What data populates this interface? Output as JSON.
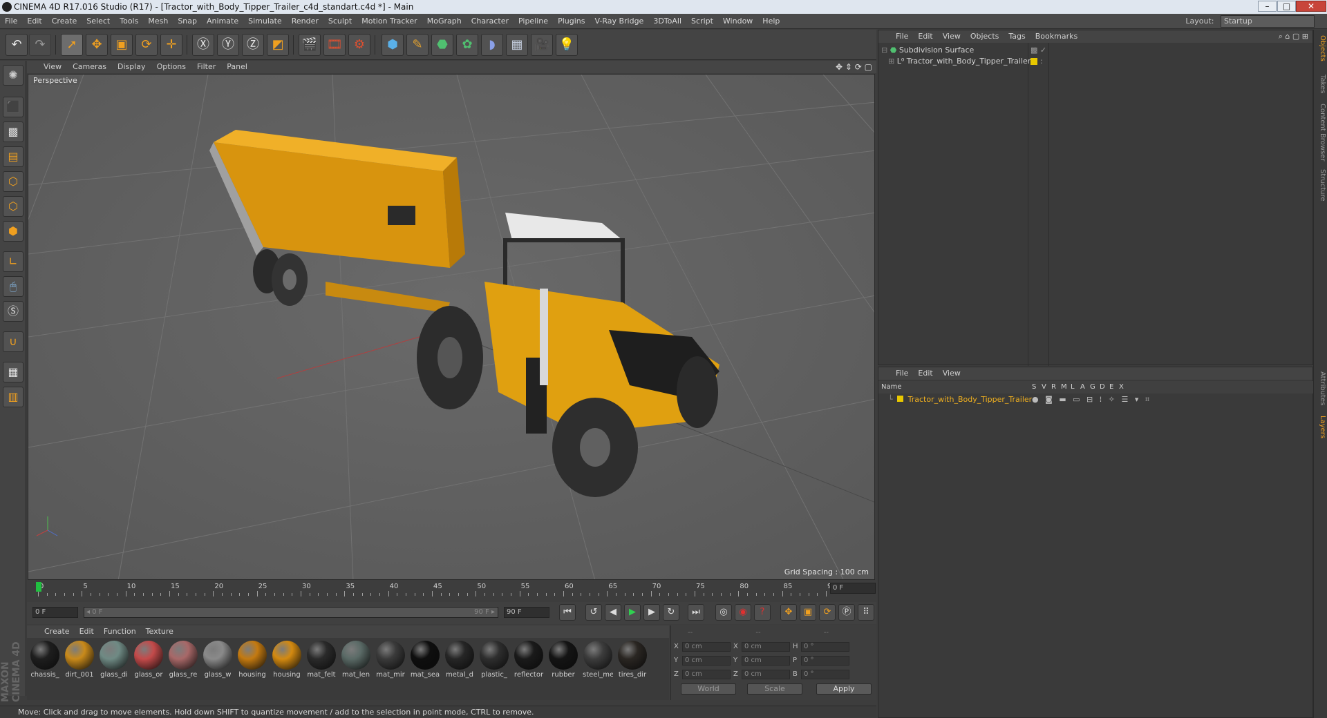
{
  "window": {
    "title": "CINEMA 4D R17.016 Studio (R17) - [Tractor_with_Body_Tipper_Trailer_c4d_standart.c4d *] - Main",
    "min": "–",
    "max": "□",
    "close": "✕"
  },
  "menu": [
    "File",
    "Edit",
    "Create",
    "Select",
    "Tools",
    "Mesh",
    "Snap",
    "Animate",
    "Simulate",
    "Render",
    "Sculpt",
    "Motion Tracker",
    "MoGraph",
    "Character",
    "Pipeline",
    "Plugins",
    "V-Ray Bridge",
    "3DToAll",
    "Script",
    "Window",
    "Help"
  ],
  "layout": {
    "label": "Layout:",
    "value": "Startup"
  },
  "viewport": {
    "menu": [
      "View",
      "Cameras",
      "Display",
      "Options",
      "Filter",
      "Panel"
    ],
    "camera_label": "Perspective",
    "grid_spacing": "Grid Spacing : 100 cm"
  },
  "timeline": {
    "ticks": [
      "0",
      "5",
      "10",
      "15",
      "20",
      "25",
      "30",
      "35",
      "40",
      "45",
      "50",
      "55",
      "60",
      "65",
      "70",
      "75",
      "80",
      "85",
      "90"
    ],
    "current_frame": "0 F"
  },
  "transport": {
    "start": "0 F",
    "range_start": "◂ 0 F",
    "range_end": "90 F ▸",
    "end": "90 F"
  },
  "materials": {
    "menu": [
      "Create",
      "Edit",
      "Function",
      "Texture"
    ],
    "items": [
      {
        "label": "chassis_",
        "color": "#1e1e1e"
      },
      {
        "label": "dirt_001",
        "color": "#c98a1a"
      },
      {
        "label": "glass_di",
        "color": "#6f8a84"
      },
      {
        "label": "glass_or",
        "color": "#c44a4a"
      },
      {
        "label": "glass_re",
        "color": "#a86868"
      },
      {
        "label": "glass_w",
        "color": "#8a8a8a"
      },
      {
        "label": "housing",
        "color": "#c47a10"
      },
      {
        "label": "housing",
        "color": "#d48a10"
      },
      {
        "label": "mat_felt",
        "color": "#2a2a2a"
      },
      {
        "label": "mat_len",
        "color": "#5a6a66"
      },
      {
        "label": "mat_mir",
        "color": "#3a3a3a"
      },
      {
        "label": "mat_sea",
        "color": "#0e0e0e"
      },
      {
        "label": "metal_d",
        "color": "#262626"
      },
      {
        "label": "plastic_",
        "color": "#2e2e2e"
      },
      {
        "label": "reflector",
        "color": "#1a1a1a"
      },
      {
        "label": "rubber",
        "color": "#141414"
      },
      {
        "label": "steel_me",
        "color": "#3c3c3c"
      },
      {
        "label": "tires_dir",
        "color": "#2a2622"
      }
    ]
  },
  "coords": {
    "header": [
      "--",
      "--",
      "--"
    ],
    "rows": [
      {
        "a": "X",
        "v1": "0 cm",
        "b": "X",
        "v2": "0 cm",
        "c": "H",
        "v3": "0 °"
      },
      {
        "a": "Y",
        "v1": "0 cm",
        "b": "Y",
        "v2": "0 cm",
        "c": "P",
        "v3": "0 °"
      },
      {
        "a": "Z",
        "v1": "0 cm",
        "b": "Z",
        "v2": "0 cm",
        "c": "B",
        "v3": "0 °"
      }
    ],
    "mode": "World",
    "size_mode": "Scale",
    "apply": "Apply"
  },
  "status": "Move: Click and drag to move elements. Hold down SHIFT to quantize movement / add to the selection in point mode, CTRL to remove.",
  "branding": "MAXON CINEMA 4D",
  "objects": {
    "menu": [
      "File",
      "Edit",
      "View",
      "Objects",
      "Tags",
      "Bookmarks"
    ],
    "items": [
      {
        "name": "Subdivision Surface"
      },
      {
        "name": "Tractor_with_Body_Tipper_Trailer"
      }
    ]
  },
  "layers": {
    "menu": [
      "File",
      "Edit",
      "View"
    ],
    "header_name": "Name",
    "columns": [
      "S",
      "V",
      "R",
      "M",
      "L",
      "A",
      "G",
      "D",
      "E",
      "X"
    ],
    "row": "Tractor_with_Body_Tipper_Trailer",
    "row_color": "#e8b400"
  },
  "side_tabs": [
    "Objects",
    "Takes",
    "Content Browser",
    "Structure",
    "Attributes",
    "Layers"
  ]
}
